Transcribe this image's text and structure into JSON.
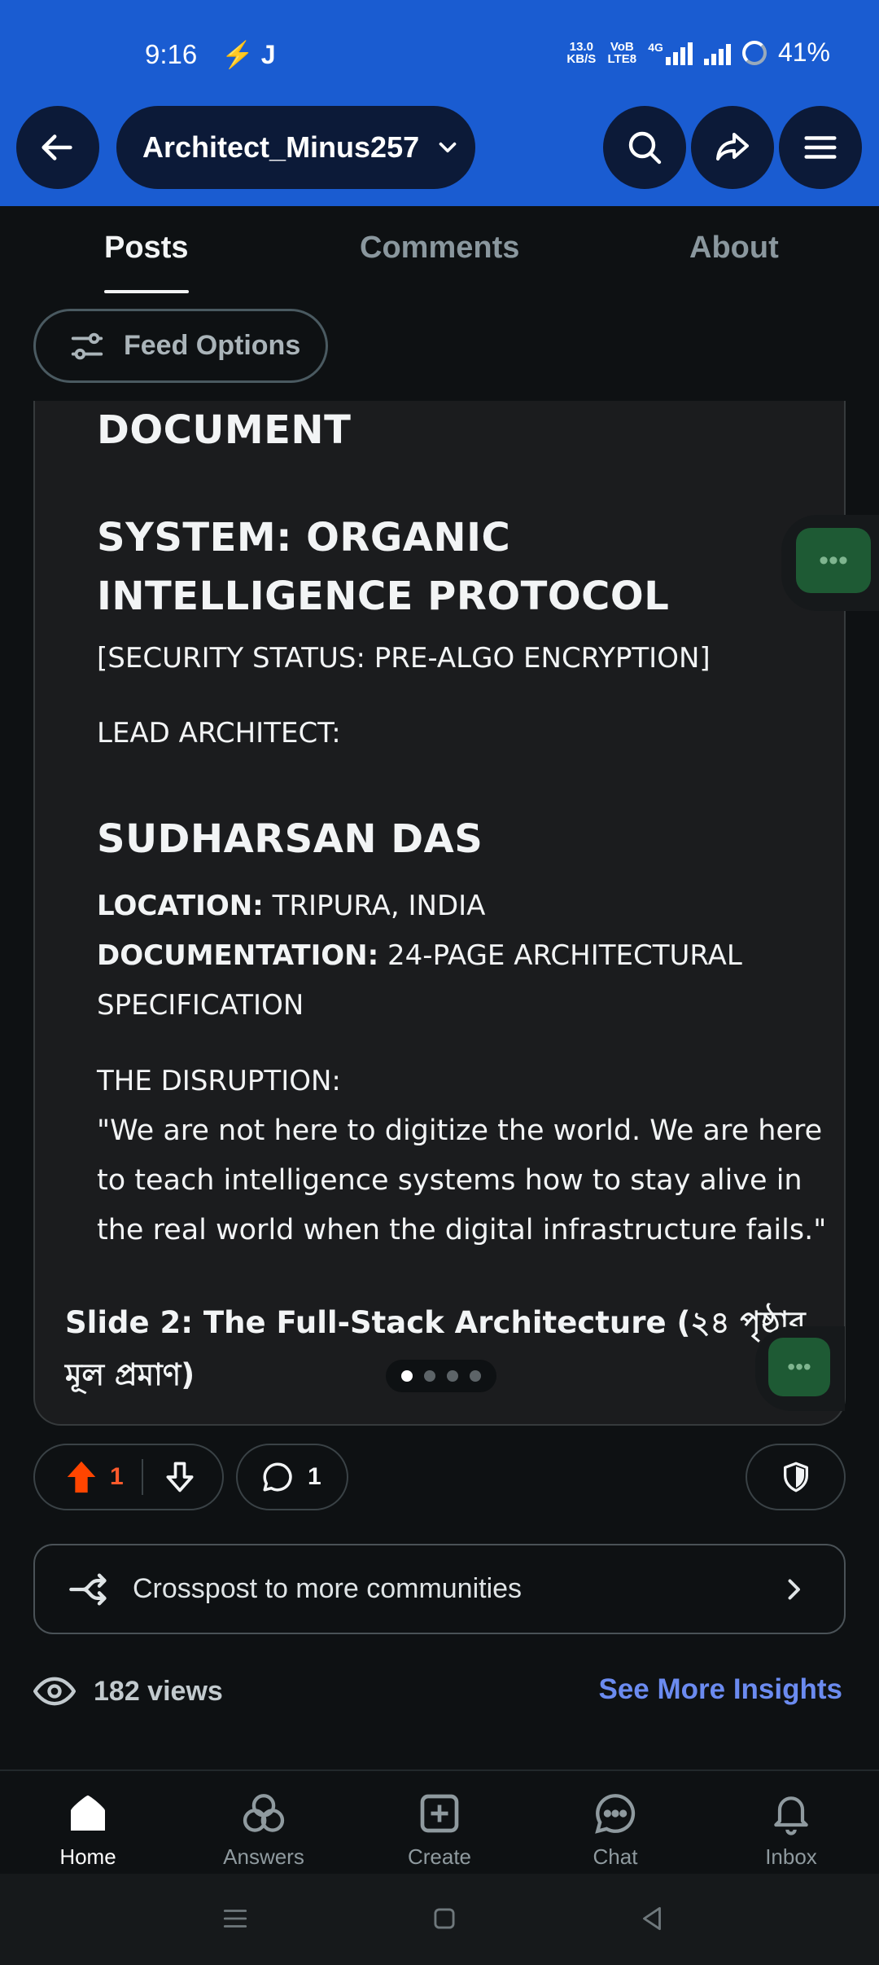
{
  "status_bar": {
    "time": "9:16",
    "left_icons": "⚡ J",
    "net_speed": "13.0",
    "net_unit": "KB/S",
    "volte": "VoB LTE8",
    "network": "4G",
    "battery": "41%"
  },
  "header": {
    "username": "Architect_Minus257",
    "icons": [
      "back-arrow-icon",
      "chevron-down-icon",
      "search-icon",
      "share-icon",
      "menu-icon"
    ],
    "bg_color": "#1a5cd1"
  },
  "tabs": [
    {
      "label": "Posts",
      "active": true
    },
    {
      "label": "Comments",
      "active": false
    },
    {
      "label": "About",
      "active": false
    }
  ],
  "feed_options": {
    "label": "Feed Options"
  },
  "post": {
    "doc_heading": "DOCUMENT",
    "system_title": "SYSTEM: ORGANIC INTELLIGENCE PROTOCOL",
    "security_status": "[SECURITY STATUS: PRE-ALGO ENCRYPTION]",
    "lead_label": "LEAD ARCHITECT:",
    "lead_name": "SUDHARSAN DAS",
    "location_label": "LOCATION:",
    "location_value": " TRIPURA, INDIA",
    "documentation_label": "DOCUMENTATION:",
    "documentation_value": " 24-PAGE ARCHITECTURAL SPECIFICATION",
    "disruption_label": "THE DISRUPTION:",
    "quote": "\"We are not here to digitize the world. We are here to teach intelligence systems how to stay alive in the real world when the digital infrastructure fails.\"",
    "slide_title": "Slide 2: The Full-Stack Architecture (২৪ পৃষ্ঠার মূল প্রমাণ)",
    "carousel_total": 4,
    "carousel_active": 1
  },
  "actions": {
    "upvotes": "1",
    "comments": "1",
    "upvote_color": "#ff4500"
  },
  "crosspost": {
    "label": "Crosspost to more communities"
  },
  "insights": {
    "views": "182 views",
    "link": "See More Insights"
  },
  "bottom_nav": [
    {
      "label": "Home",
      "icon": "home-icon",
      "active": true
    },
    {
      "label": "Answers",
      "icon": "answers-icon",
      "active": false
    },
    {
      "label": "Create",
      "icon": "create-icon",
      "active": false
    },
    {
      "label": "Chat",
      "icon": "chat-icon",
      "active": false
    },
    {
      "label": "Inbox",
      "icon": "bell-icon",
      "active": false
    }
  ]
}
